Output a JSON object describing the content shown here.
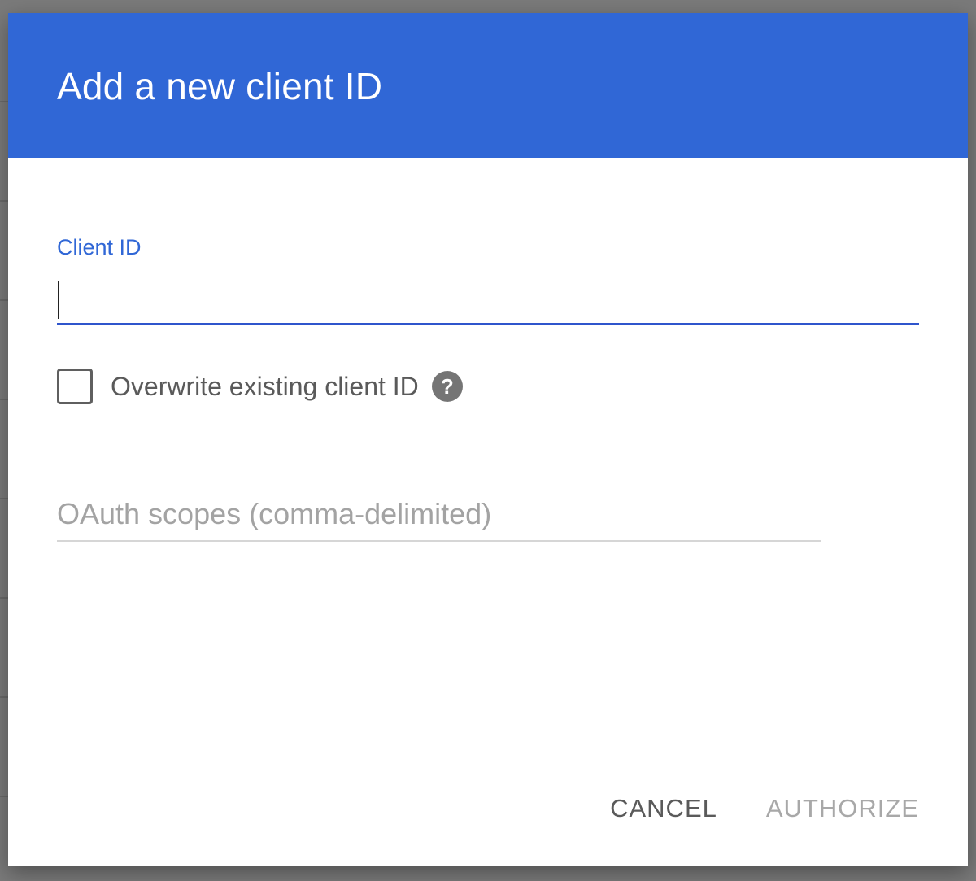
{
  "dialog": {
    "title": "Add a new client ID",
    "accent_color": "#3067d6"
  },
  "client_id_field": {
    "label": "Client ID",
    "value": ""
  },
  "overwrite_checkbox": {
    "label": "Overwrite existing client ID",
    "checked": false,
    "help_icon": "help-icon"
  },
  "scopes_field": {
    "placeholder": "OAuth scopes (comma-delimited)",
    "value": ""
  },
  "actions": {
    "cancel_label": "CANCEL",
    "authorize_label": "AUTHORIZE"
  }
}
